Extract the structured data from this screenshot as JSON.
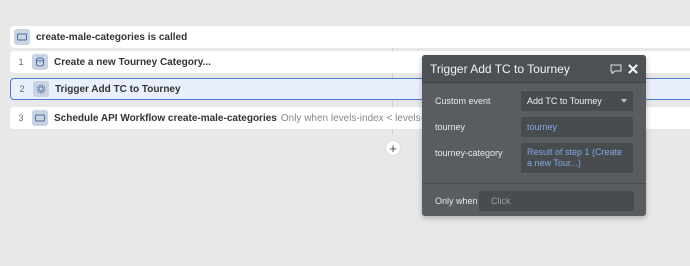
{
  "event": {
    "title": "create-male-categories is called",
    "icon": "event-icon"
  },
  "steps": [
    {
      "num": "1",
      "label": "Create a new Tourney Category...",
      "condition": "",
      "icon": "database-icon"
    },
    {
      "num": "2",
      "label": "Trigger Add TC to Tourney",
      "condition": "",
      "icon": "gear-icon"
    },
    {
      "num": "3",
      "label": "Schedule API Workflow create-male-categories",
      "condition": "Only when levels-index < levels-total",
      "icon": "workflow-icon"
    }
  ],
  "add_button": {
    "label": "+"
  },
  "panel": {
    "title": "Trigger Add TC to Tourney",
    "custom_event_label": "Custom event",
    "custom_event_value": "Add TC to Tourney",
    "tourney_label": "tourney",
    "tourney_value": "tourney",
    "tourney_category_label": "tourney-category",
    "tourney_category_value": "Result of step 1 (Create a new Tour...)",
    "only_when_label": "Only when",
    "only_when_placeholder": "Click"
  },
  "colors": {
    "selected_border": "#4a7ad0",
    "dynamic_text": "#7fa9e6",
    "panel_bg": "#5a5d5f"
  }
}
